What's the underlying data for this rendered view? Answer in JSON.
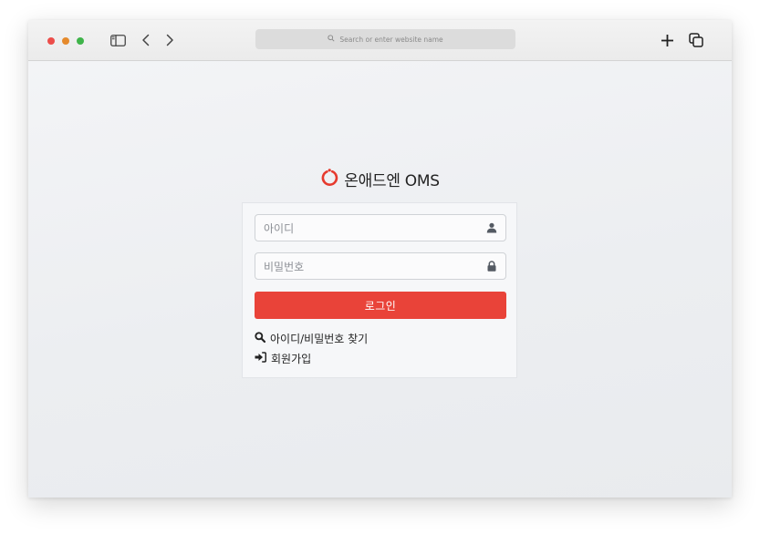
{
  "browser": {
    "address_placeholder": "Search or enter website name",
    "icons": [
      "close-dot",
      "minimize-dot",
      "zoom-dot",
      "sidebar-icon",
      "back-icon",
      "forward-icon",
      "search-icon",
      "plus-icon",
      "tabs-icon"
    ]
  },
  "page": {
    "brand": {
      "name": "온애드엔 OMS",
      "logo_icon": "ring-logo",
      "accent": "#e63a2e"
    },
    "form": {
      "username_placeholder": "아이디",
      "username_icon": "user-icon",
      "password_placeholder": "비밀번호",
      "password_icon": "lock-icon",
      "login_label": "로그인",
      "login_color": "#e94339"
    },
    "links": [
      {
        "label": "아이디/비밀번호 찾기",
        "icon": "search-icon"
      },
      {
        "label": "회원가입",
        "icon": "sign-in-icon"
      }
    ]
  }
}
